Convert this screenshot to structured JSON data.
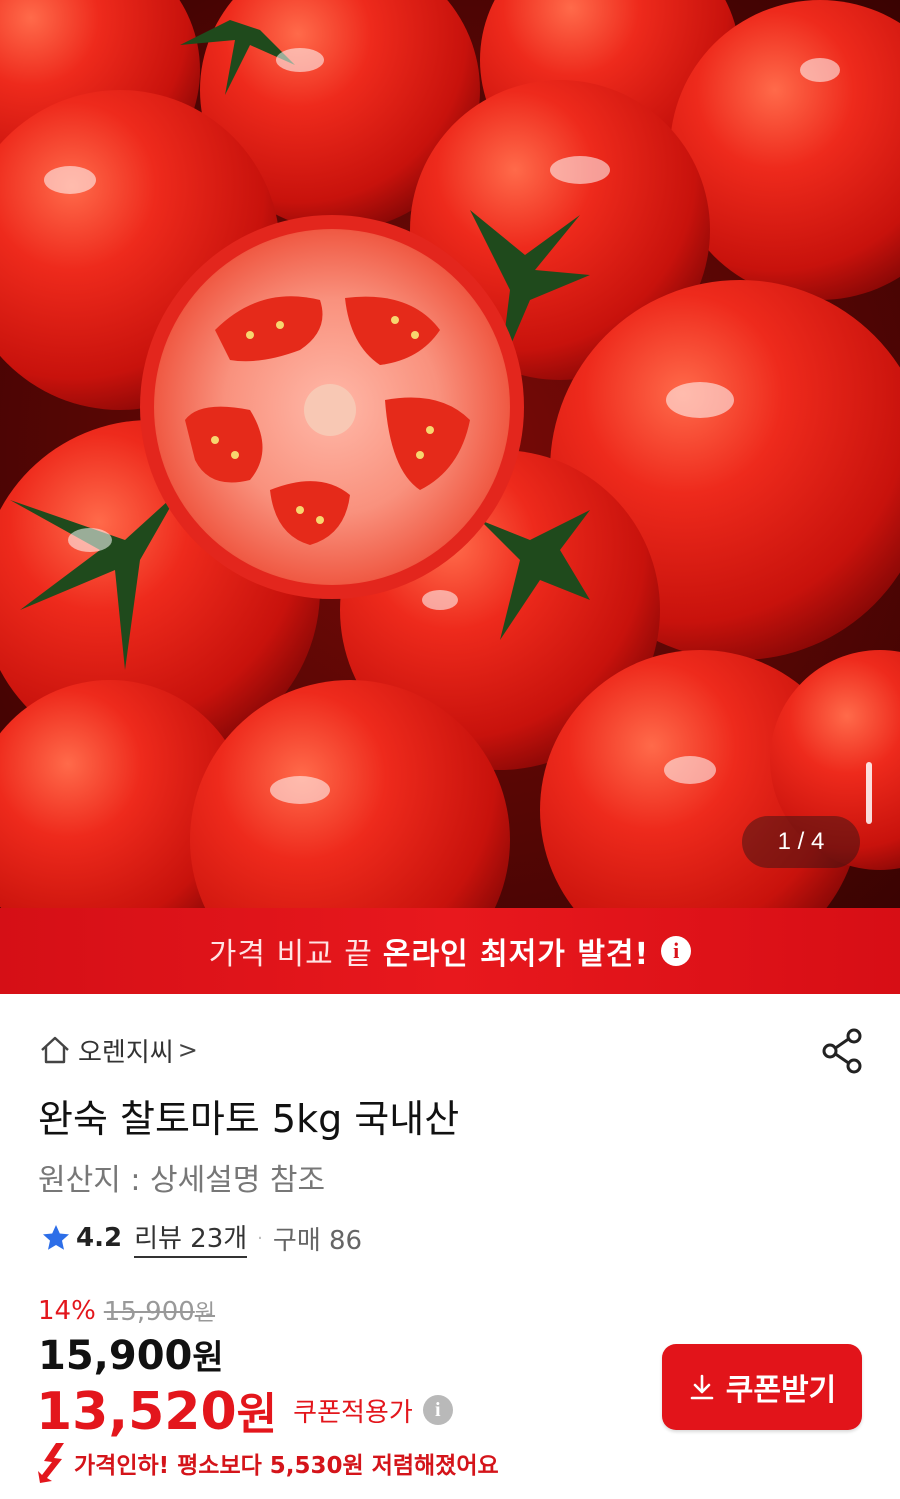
{
  "colors": {
    "accent_red": "#e2141a",
    "banner_red": "#e8181d",
    "tomato": "#e3261d"
  },
  "gallery": {
    "image_alt_icon": "tomato-photo",
    "pager_text": "1 / 4"
  },
  "banner": {
    "light_text": "가격 비교 끝",
    "bold_text": "온라인 최저가 발견!",
    "info_symbol": "i"
  },
  "product": {
    "store_name": "오렌지씨",
    "store_chevron": ">",
    "title": "완숙 찰토마토 5kg 국내산",
    "origin": "원산지 : 상세설명 참조",
    "rating": "4.2",
    "review_label": "리뷰 23개",
    "dot": "·",
    "purchase_label": "구매 86"
  },
  "pricing": {
    "discount_rate": "14%",
    "original_price": "15,900",
    "original_unit": "원",
    "price": "15,900",
    "price_unit": "원",
    "coupon_price": "13,520",
    "coupon_unit": "원",
    "coupon_label": "쿠폰적용가",
    "info_symbol": "i",
    "drop_message": "가격인하! 평소보다 5,530원 저렴해졌어요"
  },
  "actions": {
    "coupon_button_label": "쿠폰받기"
  }
}
